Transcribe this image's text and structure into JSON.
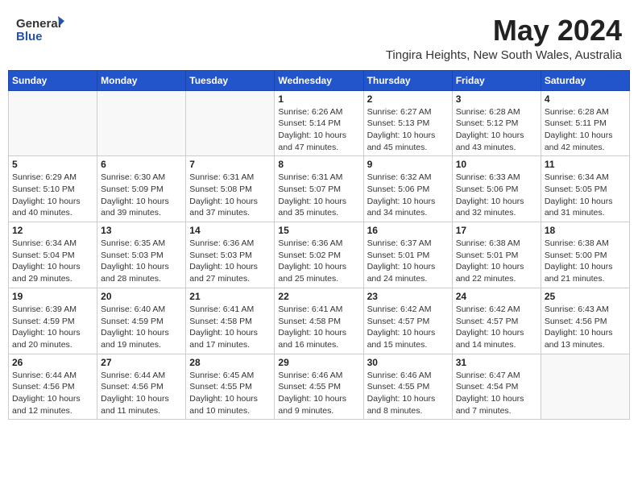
{
  "header": {
    "logo_general": "General",
    "logo_blue": "Blue",
    "month_year": "May 2024",
    "location": "Tingira Heights, New South Wales, Australia"
  },
  "days_of_week": [
    "Sunday",
    "Monday",
    "Tuesday",
    "Wednesday",
    "Thursday",
    "Friday",
    "Saturday"
  ],
  "weeks": [
    [
      {
        "day": "",
        "info": ""
      },
      {
        "day": "",
        "info": ""
      },
      {
        "day": "",
        "info": ""
      },
      {
        "day": "1",
        "info": "Sunrise: 6:26 AM\nSunset: 5:14 PM\nDaylight: 10 hours\nand 47 minutes."
      },
      {
        "day": "2",
        "info": "Sunrise: 6:27 AM\nSunset: 5:13 PM\nDaylight: 10 hours\nand 45 minutes."
      },
      {
        "day": "3",
        "info": "Sunrise: 6:28 AM\nSunset: 5:12 PM\nDaylight: 10 hours\nand 43 minutes."
      },
      {
        "day": "4",
        "info": "Sunrise: 6:28 AM\nSunset: 5:11 PM\nDaylight: 10 hours\nand 42 minutes."
      }
    ],
    [
      {
        "day": "5",
        "info": "Sunrise: 6:29 AM\nSunset: 5:10 PM\nDaylight: 10 hours\nand 40 minutes."
      },
      {
        "day": "6",
        "info": "Sunrise: 6:30 AM\nSunset: 5:09 PM\nDaylight: 10 hours\nand 39 minutes."
      },
      {
        "day": "7",
        "info": "Sunrise: 6:31 AM\nSunset: 5:08 PM\nDaylight: 10 hours\nand 37 minutes."
      },
      {
        "day": "8",
        "info": "Sunrise: 6:31 AM\nSunset: 5:07 PM\nDaylight: 10 hours\nand 35 minutes."
      },
      {
        "day": "9",
        "info": "Sunrise: 6:32 AM\nSunset: 5:06 PM\nDaylight: 10 hours\nand 34 minutes."
      },
      {
        "day": "10",
        "info": "Sunrise: 6:33 AM\nSunset: 5:06 PM\nDaylight: 10 hours\nand 32 minutes."
      },
      {
        "day": "11",
        "info": "Sunrise: 6:34 AM\nSunset: 5:05 PM\nDaylight: 10 hours\nand 31 minutes."
      }
    ],
    [
      {
        "day": "12",
        "info": "Sunrise: 6:34 AM\nSunset: 5:04 PM\nDaylight: 10 hours\nand 29 minutes."
      },
      {
        "day": "13",
        "info": "Sunrise: 6:35 AM\nSunset: 5:03 PM\nDaylight: 10 hours\nand 28 minutes."
      },
      {
        "day": "14",
        "info": "Sunrise: 6:36 AM\nSunset: 5:03 PM\nDaylight: 10 hours\nand 27 minutes."
      },
      {
        "day": "15",
        "info": "Sunrise: 6:36 AM\nSunset: 5:02 PM\nDaylight: 10 hours\nand 25 minutes."
      },
      {
        "day": "16",
        "info": "Sunrise: 6:37 AM\nSunset: 5:01 PM\nDaylight: 10 hours\nand 24 minutes."
      },
      {
        "day": "17",
        "info": "Sunrise: 6:38 AM\nSunset: 5:01 PM\nDaylight: 10 hours\nand 22 minutes."
      },
      {
        "day": "18",
        "info": "Sunrise: 6:38 AM\nSunset: 5:00 PM\nDaylight: 10 hours\nand 21 minutes."
      }
    ],
    [
      {
        "day": "19",
        "info": "Sunrise: 6:39 AM\nSunset: 4:59 PM\nDaylight: 10 hours\nand 20 minutes."
      },
      {
        "day": "20",
        "info": "Sunrise: 6:40 AM\nSunset: 4:59 PM\nDaylight: 10 hours\nand 19 minutes."
      },
      {
        "day": "21",
        "info": "Sunrise: 6:41 AM\nSunset: 4:58 PM\nDaylight: 10 hours\nand 17 minutes."
      },
      {
        "day": "22",
        "info": "Sunrise: 6:41 AM\nSunset: 4:58 PM\nDaylight: 10 hours\nand 16 minutes."
      },
      {
        "day": "23",
        "info": "Sunrise: 6:42 AM\nSunset: 4:57 PM\nDaylight: 10 hours\nand 15 minutes."
      },
      {
        "day": "24",
        "info": "Sunrise: 6:42 AM\nSunset: 4:57 PM\nDaylight: 10 hours\nand 14 minutes."
      },
      {
        "day": "25",
        "info": "Sunrise: 6:43 AM\nSunset: 4:56 PM\nDaylight: 10 hours\nand 13 minutes."
      }
    ],
    [
      {
        "day": "26",
        "info": "Sunrise: 6:44 AM\nSunset: 4:56 PM\nDaylight: 10 hours\nand 12 minutes."
      },
      {
        "day": "27",
        "info": "Sunrise: 6:44 AM\nSunset: 4:56 PM\nDaylight: 10 hours\nand 11 minutes."
      },
      {
        "day": "28",
        "info": "Sunrise: 6:45 AM\nSunset: 4:55 PM\nDaylight: 10 hours\nand 10 minutes."
      },
      {
        "day": "29",
        "info": "Sunrise: 6:46 AM\nSunset: 4:55 PM\nDaylight: 10 hours\nand 9 minutes."
      },
      {
        "day": "30",
        "info": "Sunrise: 6:46 AM\nSunset: 4:55 PM\nDaylight: 10 hours\nand 8 minutes."
      },
      {
        "day": "31",
        "info": "Sunrise: 6:47 AM\nSunset: 4:54 PM\nDaylight: 10 hours\nand 7 minutes."
      },
      {
        "day": "",
        "info": ""
      }
    ]
  ]
}
